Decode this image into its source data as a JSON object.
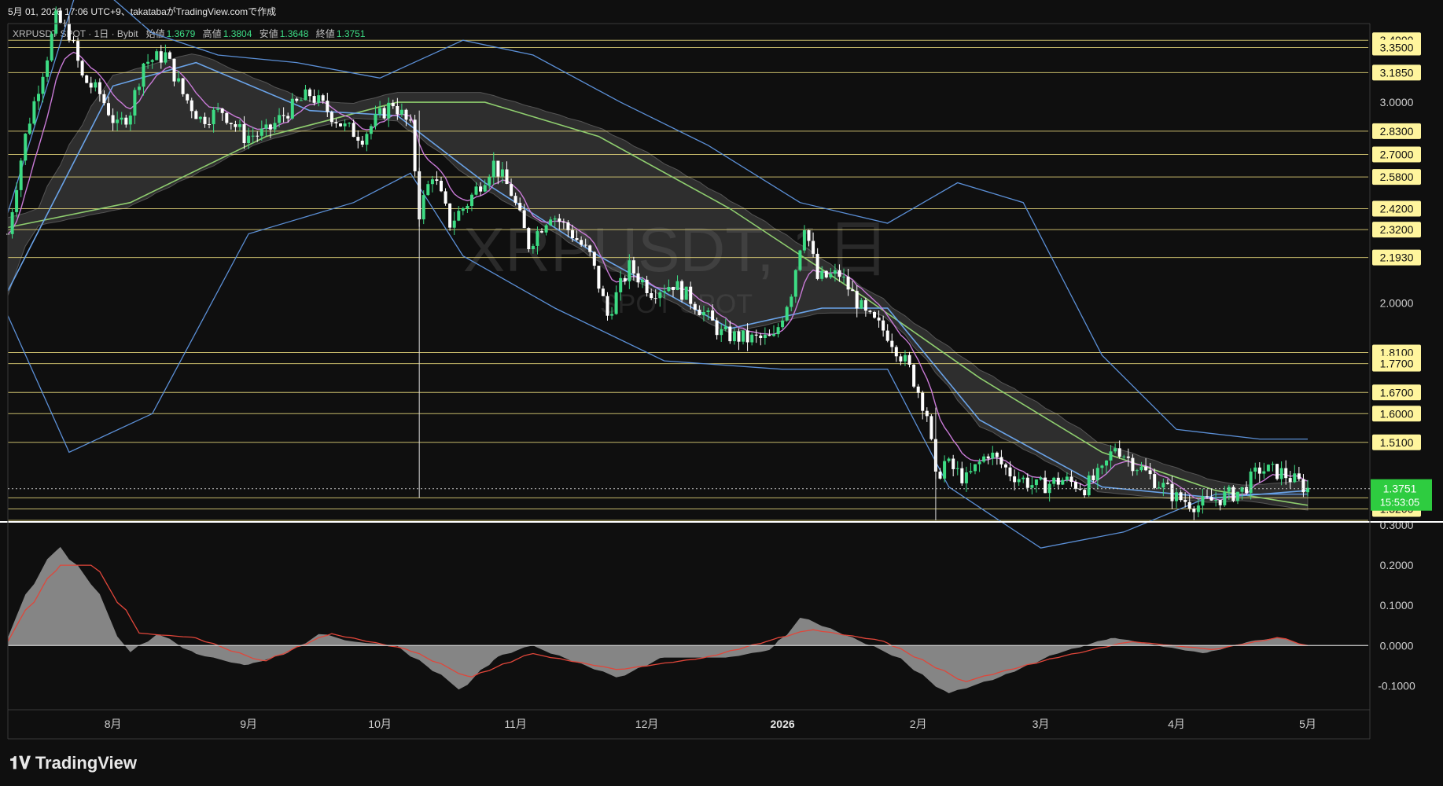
{
  "header": {
    "created_text": "5月 01, 2026 17:06 UTC+9、takatabaがTradingView.comで作成"
  },
  "symbol_row": {
    "symbol": "XRPUSDT SPOT · 1日 · Bybit",
    "open_label": "始値",
    "open": "1.3679",
    "high_label": "高値",
    "high": "1.3804",
    "low_label": "安値",
    "low": "1.3648",
    "close_label": "終値",
    "close": "1.3751"
  },
  "watermark": {
    "line1": "XRPUSDT, 1日",
    "line2": "SPOT SPOT"
  },
  "logo": {
    "text": "TradingView",
    "icon": "tradingview-logo-icon"
  },
  "colors": {
    "background": "#0f0f0f",
    "candle_up": "#3ddc84",
    "candle_down": "#ffffff",
    "level_line": "#e6d77a",
    "level_box": "#fff59d",
    "price_box": "#2ecc40",
    "bollinger": "#5b8fd6",
    "ma_long": "#8fce6f",
    "ma_short": "#c87ad6",
    "cloud": "#6a6a6a",
    "macd_area": "#9a9a9a",
    "macd_signal": "#e0463a"
  },
  "price_axis": {
    "highlighted_levels": [
      "3.4000",
      "3.3500",
      "3.1850",
      "2.8300",
      "2.7000",
      "2.5800",
      "2.4200",
      "2.3200",
      "2.1930",
      "1.8100",
      "1.7700",
      "1.6700",
      "1.6000",
      "1.5100",
      "1.3500",
      "1.3200"
    ],
    "plain_labels": [
      "3.0000",
      "2.0000"
    ],
    "current_price": "1.3751",
    "countdown": "15:53:05"
  },
  "macd_axis": {
    "labels": [
      "0.3000",
      "0.2000",
      "0.1000",
      "0.0000",
      "-0.1000"
    ]
  },
  "time_axis": {
    "labels": [
      "8月",
      "9月",
      "10月",
      "11月",
      "12月",
      "2026",
      "2月",
      "3月",
      "4月",
      "5月"
    ],
    "bold_label": "2026"
  },
  "chart_data": [
    {
      "type": "candlestick",
      "title": "XRPUSDT SPOT · 1日 · Bybit",
      "xlabel": "",
      "ylabel": "",
      "x_range": [
        "2025-07-08",
        "2026-05-01"
      ],
      "ylim": [
        1.29,
        3.45
      ],
      "y_scale": "log",
      "grid": false,
      "horizontal_levels": [
        3.4,
        3.35,
        3.185,
        2.83,
        2.7,
        2.58,
        2.42,
        2.32,
        2.193,
        1.81,
        1.77,
        1.67,
        1.6,
        1.51,
        1.35,
        1.32,
        1.29
      ],
      "close_path": [
        {
          "date": "2025-07-08",
          "close": 2.3
        },
        {
          "date": "2025-07-12",
          "close": 2.8
        },
        {
          "date": "2025-07-17",
          "close": 3.3
        },
        {
          "date": "2025-07-19",
          "close": 3.55
        },
        {
          "date": "2025-07-22",
          "close": 3.45
        },
        {
          "date": "2025-07-25",
          "close": 3.15
        },
        {
          "date": "2025-07-29",
          "close": 3.05
        },
        {
          "date": "2025-08-02",
          "close": 2.85
        },
        {
          "date": "2025-08-05",
          "close": 2.95
        },
        {
          "date": "2025-08-08",
          "close": 3.25
        },
        {
          "date": "2025-08-13",
          "close": 3.3
        },
        {
          "date": "2025-08-17",
          "close": 3.05
        },
        {
          "date": "2025-08-21",
          "close": 2.9
        },
        {
          "date": "2025-08-26",
          "close": 2.95
        },
        {
          "date": "2025-08-31",
          "close": 2.8
        },
        {
          "date": "2025-09-05",
          "close": 2.82
        },
        {
          "date": "2025-09-10",
          "close": 2.95
        },
        {
          "date": "2025-09-15",
          "close": 3.05
        },
        {
          "date": "2025-09-19",
          "close": 2.95
        },
        {
          "date": "2025-09-23",
          "close": 2.85
        },
        {
          "date": "2025-09-27",
          "close": 2.8
        },
        {
          "date": "2025-10-01",
          "close": 2.92
        },
        {
          "date": "2025-10-04",
          "close": 3.0
        },
        {
          "date": "2025-10-08",
          "close": 2.85
        },
        {
          "date": "2025-10-10",
          "close": 2.4
        },
        {
          "date": "2025-10-13",
          "close": 2.6
        },
        {
          "date": "2025-10-17",
          "close": 2.35
        },
        {
          "date": "2025-10-21",
          "close": 2.45
        },
        {
          "date": "2025-10-27",
          "close": 2.65
        },
        {
          "date": "2025-10-31",
          "close": 2.5
        },
        {
          "date": "2025-11-04",
          "close": 2.25
        },
        {
          "date": "2025-11-09",
          "close": 2.4
        },
        {
          "date": "2025-11-14",
          "close": 2.3
        },
        {
          "date": "2025-11-18",
          "close": 2.2
        },
        {
          "date": "2025-11-22",
          "close": 1.95
        },
        {
          "date": "2025-11-27",
          "close": 2.15
        },
        {
          "date": "2025-12-02",
          "close": 2.05
        },
        {
          "date": "2025-12-07",
          "close": 2.08
        },
        {
          "date": "2025-12-12",
          "close": 2.0
        },
        {
          "date": "2025-12-18",
          "close": 1.88
        },
        {
          "date": "2025-12-24",
          "close": 1.86
        },
        {
          "date": "2025-12-30",
          "close": 1.86
        },
        {
          "date": "2026-01-03",
          "close": 2.05
        },
        {
          "date": "2026-01-06",
          "close": 2.35
        },
        {
          "date": "2026-01-09",
          "close": 2.1
        },
        {
          "date": "2026-01-14",
          "close": 2.12
        },
        {
          "date": "2026-01-20",
          "close": 1.95
        },
        {
          "date": "2026-01-25",
          "close": 1.88
        },
        {
          "date": "2026-01-30",
          "close": 1.75
        },
        {
          "date": "2026-02-03",
          "close": 1.6
        },
        {
          "date": "2026-02-05",
          "close": 1.4
        },
        {
          "date": "2026-02-07",
          "close": 1.45
        },
        {
          "date": "2026-02-12",
          "close": 1.4
        },
        {
          "date": "2026-02-17",
          "close": 1.48
        },
        {
          "date": "2026-02-22",
          "close": 1.42
        },
        {
          "date": "2026-02-28",
          "close": 1.38
        },
        {
          "date": "2026-03-06",
          "close": 1.4
        },
        {
          "date": "2026-03-11",
          "close": 1.38
        },
        {
          "date": "2026-03-15",
          "close": 1.42
        },
        {
          "date": "2026-03-18",
          "close": 1.5
        },
        {
          "date": "2026-03-22",
          "close": 1.45
        },
        {
          "date": "2026-03-27",
          "close": 1.4
        },
        {
          "date": "2026-04-01",
          "close": 1.35
        },
        {
          "date": "2026-04-06",
          "close": 1.33
        },
        {
          "date": "2026-04-11",
          "close": 1.35
        },
        {
          "date": "2026-04-16",
          "close": 1.37
        },
        {
          "date": "2026-04-20",
          "close": 1.43
        },
        {
          "date": "2026-04-25",
          "close": 1.42
        },
        {
          "date": "2026-05-01",
          "close": 1.3751
        }
      ],
      "indicators": {
        "bollinger_upper": [
          {
            "date": "2025-07-08",
            "value": 2.4
          },
          {
            "date": "2025-07-25",
            "value": 3.9
          },
          {
            "date": "2025-08-10",
            "value": 3.45
          },
          {
            "date": "2025-08-25",
            "value": 3.3
          },
          {
            "date": "2025-09-12",
            "value": 3.25
          },
          {
            "date": "2025-10-01",
            "value": 3.15
          },
          {
            "date": "2025-10-20",
            "value": 3.4
          },
          {
            "date": "2025-11-05",
            "value": 3.3
          },
          {
            "date": "2025-11-25",
            "value": 3.0
          },
          {
            "date": "2025-12-15",
            "value": 2.75
          },
          {
            "date": "2026-01-05",
            "value": 2.45
          },
          {
            "date": "2026-01-25",
            "value": 2.35
          },
          {
            "date": "2026-02-10",
            "value": 2.55
          },
          {
            "date": "2026-02-25",
            "value": 2.45
          },
          {
            "date": "2026-03-15",
            "value": 1.8
          },
          {
            "date": "2026-04-01",
            "value": 1.55
          },
          {
            "date": "2026-04-20",
            "value": 1.52
          },
          {
            "date": "2026-05-01",
            "value": 1.52
          }
        ],
        "bollinger_lower": [
          {
            "date": "2025-07-08",
            "value": 1.95
          },
          {
            "date": "2025-07-22",
            "value": 1.48
          },
          {
            "date": "2025-08-10",
            "value": 1.6
          },
          {
            "date": "2025-09-01",
            "value": 2.3
          },
          {
            "date": "2025-09-25",
            "value": 2.45
          },
          {
            "date": "2025-10-08",
            "value": 2.6
          },
          {
            "date": "2025-10-20",
            "value": 2.2
          },
          {
            "date": "2025-11-10",
            "value": 1.98
          },
          {
            "date": "2025-12-05",
            "value": 1.78
          },
          {
            "date": "2026-01-01",
            "value": 1.75
          },
          {
            "date": "2026-01-25",
            "value": 1.75
          },
          {
            "date": "2026-02-08",
            "value": 1.38
          },
          {
            "date": "2026-03-01",
            "value": 1.22
          },
          {
            "date": "2026-03-20",
            "value": 1.26
          },
          {
            "date": "2026-04-10",
            "value": 1.36
          },
          {
            "date": "2026-05-01",
            "value": 1.36
          }
        ],
        "moving_average_long": [
          {
            "date": "2025-07-08",
            "value": 2.33
          },
          {
            "date": "2025-08-05",
            "value": 2.45
          },
          {
            "date": "2025-09-05",
            "value": 2.8
          },
          {
            "date": "2025-10-05",
            "value": 3.0
          },
          {
            "date": "2025-10-25",
            "value": 3.0
          },
          {
            "date": "2025-11-20",
            "value": 2.8
          },
          {
            "date": "2025-12-20",
            "value": 2.42
          },
          {
            "date": "2026-01-20",
            "value": 2.02
          },
          {
            "date": "2026-02-15",
            "value": 1.72
          },
          {
            "date": "2026-03-15",
            "value": 1.48
          },
          {
            "date": "2026-04-10",
            "value": 1.37
          },
          {
            "date": "2026-05-01",
            "value": 1.33
          }
        ],
        "moving_average_mid": [
          {
            "date": "2025-07-08",
            "value": 2.05
          },
          {
            "date": "2025-08-01",
            "value": 3.1
          },
          {
            "date": "2025-08-20",
            "value": 3.25
          },
          {
            "date": "2025-09-15",
            "value": 2.95
          },
          {
            "date": "2025-10-05",
            "value": 2.92
          },
          {
            "date": "2025-10-25",
            "value": 2.55
          },
          {
            "date": "2025-11-20",
            "value": 2.2
          },
          {
            "date": "2025-12-20",
            "value": 1.9
          },
          {
            "date": "2026-01-10",
            "value": 1.98
          },
          {
            "date": "2026-01-25",
            "value": 1.98
          },
          {
            "date": "2026-02-15",
            "value": 1.58
          },
          {
            "date": "2026-03-15",
            "value": 1.38
          },
          {
            "date": "2026-04-10",
            "value": 1.35
          },
          {
            "date": "2026-05-01",
            "value": 1.37
          }
        ]
      }
    },
    {
      "type": "area",
      "title": "",
      "xlabel": "",
      "ylabel": "",
      "ylim": [
        -0.16,
        0.3
      ],
      "grid": false,
      "series": [
        {
          "values_by_date": [
            {
              "date": "2025-07-08",
              "value": 0.02
            },
            {
              "date": "2025-07-14",
              "value": 0.15
            },
            {
              "date": "2025-07-20",
              "value": 0.25
            },
            {
              "date": "2025-07-28",
              "value": 0.15
            },
            {
              "date": "2025-08-05",
              "value": -0.02
            },
            {
              "date": "2025-08-12",
              "value": 0.03
            },
            {
              "date": "2025-08-20",
              "value": -0.02
            },
            {
              "date": "2025-09-01",
              "value": -0.05
            },
            {
              "date": "2025-09-10",
              "value": -0.02
            },
            {
              "date": "2025-09-18",
              "value": 0.03
            },
            {
              "date": "2025-09-25",
              "value": 0.01
            },
            {
              "date": "2025-10-05",
              "value": 0.0
            },
            {
              "date": "2025-10-12",
              "value": -0.05
            },
            {
              "date": "2025-10-20",
              "value": -0.11
            },
            {
              "date": "2025-10-28",
              "value": -0.03
            },
            {
              "date": "2025-11-05",
              "value": 0.0
            },
            {
              "date": "2025-11-15",
              "value": -0.04
            },
            {
              "date": "2025-11-25",
              "value": -0.08
            },
            {
              "date": "2025-12-05",
              "value": -0.03
            },
            {
              "date": "2025-12-20",
              "value": -0.03
            },
            {
              "date": "2025-12-30",
              "value": -0.01
            },
            {
              "date": "2026-01-06",
              "value": 0.07
            },
            {
              "date": "2026-01-15",
              "value": 0.03
            },
            {
              "date": "2026-01-28",
              "value": -0.03
            },
            {
              "date": "2026-02-08",
              "value": -0.12
            },
            {
              "date": "2026-02-20",
              "value": -0.08
            },
            {
              "date": "2026-03-05",
              "value": -0.02
            },
            {
              "date": "2026-03-18",
              "value": 0.02
            },
            {
              "date": "2026-03-28",
              "value": 0.0
            },
            {
              "date": "2026-04-08",
              "value": -0.02
            },
            {
              "date": "2026-04-18",
              "value": 0.01
            },
            {
              "date": "2026-04-25",
              "value": 0.02
            },
            {
              "date": "2026-05-01",
              "value": 0.0
            }
          ]
        },
        {
          "values_by_date": [
            {
              "date": "2025-07-08",
              "value": 0.01
            },
            {
              "date": "2025-07-20",
              "value": 0.2
            },
            {
              "date": "2025-07-28",
              "value": 0.2
            },
            {
              "date": "2025-08-08",
              "value": 0.03
            },
            {
              "date": "2025-08-20",
              "value": 0.02
            },
            {
              "date": "2025-09-05",
              "value": -0.04
            },
            {
              "date": "2025-09-20",
              "value": 0.03
            },
            {
              "date": "2025-10-08",
              "value": -0.01
            },
            {
              "date": "2025-10-22",
              "value": -0.08
            },
            {
              "date": "2025-11-05",
              "value": -0.02
            },
            {
              "date": "2025-11-25",
              "value": -0.06
            },
            {
              "date": "2025-12-15",
              "value": -0.03
            },
            {
              "date": "2026-01-08",
              "value": 0.04
            },
            {
              "date": "2026-01-25",
              "value": 0.01
            },
            {
              "date": "2026-02-12",
              "value": -0.09
            },
            {
              "date": "2026-03-05",
              "value": -0.03
            },
            {
              "date": "2026-03-22",
              "value": 0.01
            },
            {
              "date": "2026-04-10",
              "value": -0.01
            },
            {
              "date": "2026-04-25",
              "value": 0.02
            },
            {
              "date": "2026-05-01",
              "value": 0.0
            }
          ]
        }
      ]
    }
  ]
}
